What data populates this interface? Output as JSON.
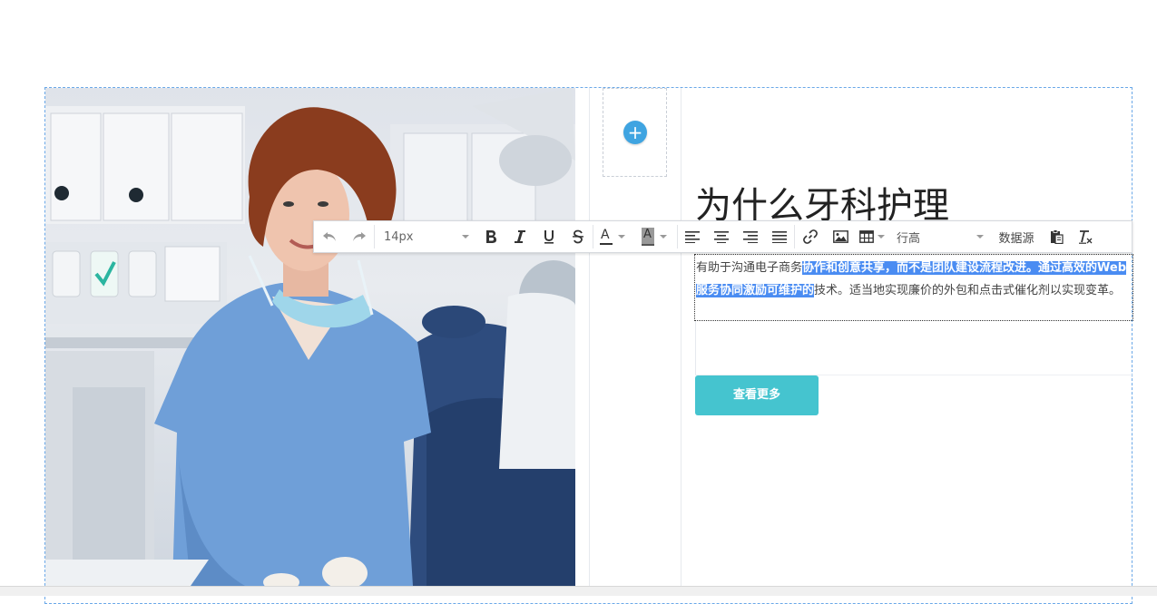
{
  "hero": {
    "heading": "为什么牙科护理",
    "button_label": "查看更多",
    "paragraph": {
      "part1": "有助于沟通电子商务",
      "highlight": "协作和创意共享，而不是团队建设流程改进。通过高效的Web服务协同激励可维护的",
      "part2": "技术。适当地实现廉价的外包和点击式催化剂以实现变革。"
    }
  },
  "toolbar": {
    "font_size": "14px",
    "line_height_label": "行高",
    "datasource_label": "数据源",
    "font_color_letter": "A",
    "bg_color_letter": "A"
  },
  "add_widget": {
    "label": "+"
  },
  "icons": {
    "undo": "undo-icon",
    "redo": "redo-icon",
    "bold": "bold-icon",
    "italic": "italic-icon",
    "underline": "underline-icon",
    "strike": "strikethrough-icon",
    "align_left": "align-left-icon",
    "align_center": "align-center-icon",
    "align_right": "align-right-icon",
    "justify": "justify-icon",
    "link": "link-icon",
    "image": "image-icon",
    "table": "table-icon",
    "paste": "paste-icon",
    "clear_format": "clear-format-icon"
  },
  "colors": {
    "accent": "#45c4cf",
    "add_button": "#3fa4e1",
    "selection": "#4a8cf2",
    "outline": "#6aa8e8"
  }
}
